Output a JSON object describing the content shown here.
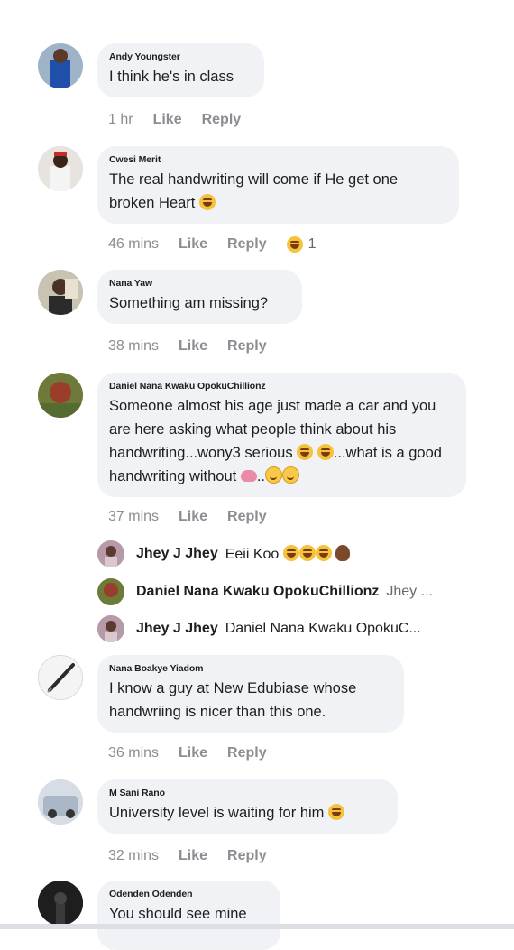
{
  "comments": [
    {
      "author": "Andy Youngster",
      "text": "I think he's in class",
      "time": "1 hr",
      "like": "Like",
      "reply": "Reply"
    },
    {
      "author": "Cwesi Merit",
      "text": "The real handwriting will come if He get one broken Heart",
      "time": "46 mins",
      "like": "Like",
      "reply": "Reply",
      "reaction_count": "1"
    },
    {
      "author": "Nana Yaw",
      "text": "Something am missing?",
      "time": "38 mins",
      "like": "Like",
      "reply": "Reply"
    },
    {
      "author": "Daniel Nana Kwaku OpokuChillionz",
      "text_part1": "Someone almost his age just made a car and you are here asking what people think about his handwriting...wony3 serious",
      "text_part2": "...what is a good handwriting without",
      "text_part3": "..",
      "time": "37 mins",
      "like": "Like",
      "reply": "Reply"
    },
    {
      "author": "Nana Boakye Yiadom",
      "text": "I know a guy at New Edubiase whose handwriing is nicer than this one.",
      "time": "36 mins",
      "like": "Like",
      "reply": "Reply"
    },
    {
      "author": "M Sani Rano",
      "text": "University level is waiting for him",
      "time": "32 mins",
      "like": "Like",
      "reply": "Reply"
    },
    {
      "author": "Odenden Odenden",
      "text": "You should see mine"
    }
  ],
  "replies": [
    {
      "author": "Jhey J Jhey",
      "text": "Eeii Koo"
    },
    {
      "author": "Daniel Nana Kwaku OpokuChillionz",
      "text": "Jhey ..."
    },
    {
      "author": "Jhey J Jhey",
      "text": "Daniel Nana Kwaku OpokuC..."
    }
  ],
  "icons": {
    "laugh": "laughing-emoji",
    "smile": "smiling-emoji",
    "brain": "brain-emoji",
    "woman": "woman-emoji"
  }
}
